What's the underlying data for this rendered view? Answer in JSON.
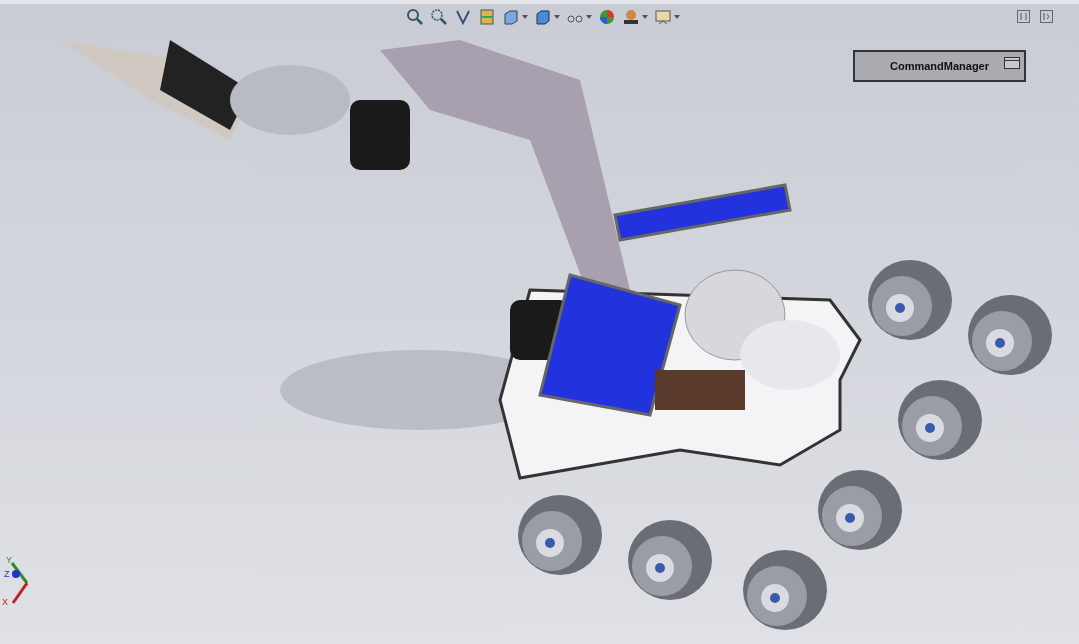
{
  "command_manager": {
    "label": "CommandManager"
  },
  "triad": {
    "axes": [
      {
        "label": "Y"
      },
      {
        "label": "Z"
      },
      {
        "label": "X"
      }
    ]
  }
}
